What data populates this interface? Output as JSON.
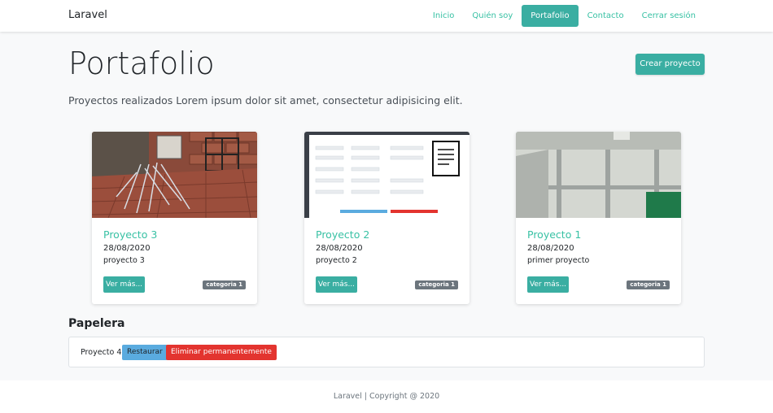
{
  "navbar": {
    "brand": "Laravel",
    "links": [
      "Inicio",
      "Quién soy",
      "Portafolio",
      "Contacto",
      "Cerrar sesión"
    ],
    "active_link": "Portafolio"
  },
  "header": {
    "title": "Portafolio",
    "create_button": "Crear proyecto",
    "lead": "Proyectos realizados Lorem ipsum dolor sit amet, consectetur adipisicing elit."
  },
  "projects": [
    {
      "title": "Proyecto 3",
      "date": "28/08/2020",
      "description": "proyecto 3",
      "button": "Ver más...",
      "category": "categoria 1",
      "image": "brick-wall-cables-photo"
    },
    {
      "title": "Proyecto 2",
      "date": "28/08/2020",
      "description": "proyecto 2",
      "button": "Ver más...",
      "category": "categoria 1",
      "image": "form-screenshot"
    },
    {
      "title": "Proyecto 1",
      "date": "28/08/2020",
      "description": "primer proyecto",
      "button": "Ver más...",
      "category": "categoria 1",
      "image": "room-interior-photo"
    }
  ],
  "trash": {
    "title": "Papelera",
    "item_name": "Proyecto 4",
    "restore_button": "Restaurar",
    "delete_button": "Eliminar permanentemente"
  },
  "footer": {
    "text": "Laravel | Copyright @ 2020"
  },
  "colors": {
    "accent": "#3aaea2",
    "link": "#38c1a4",
    "restore": "#5aabdf",
    "danger": "#e3342f",
    "badge": "#6c757d"
  }
}
